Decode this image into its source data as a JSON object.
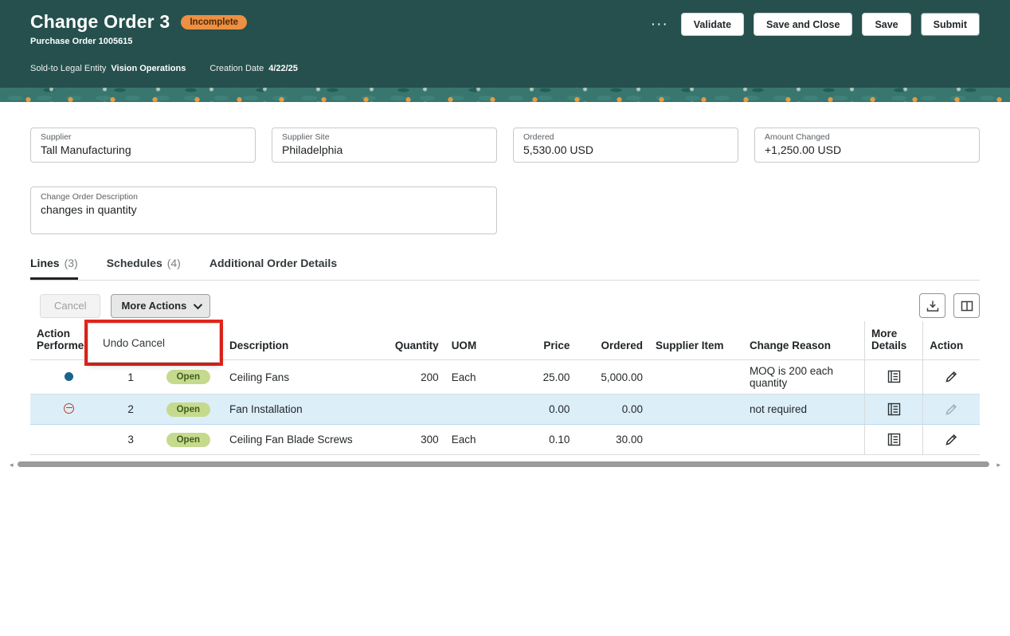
{
  "header": {
    "title": "Change Order 3",
    "status_badge": "Incomplete",
    "subtitle": "Purchase Order 1005615",
    "sold_to_label": "Sold-to Legal Entity",
    "sold_to_value": "Vision Operations",
    "creation_date_label": "Creation Date",
    "creation_date_value": "4/22/25",
    "overflow_glyph": "···",
    "buttons": [
      "Validate",
      "Save and Close",
      "Save",
      "Submit"
    ]
  },
  "fields": [
    {
      "label": "Supplier",
      "value": "Tall Manufacturing"
    },
    {
      "label": "Supplier Site",
      "value": "Philadelphia"
    },
    {
      "label": "Ordered",
      "value": "5,530.00 USD"
    },
    {
      "label": "Amount Changed",
      "value": "+1,250.00 USD"
    }
  ],
  "description_field": {
    "label": "Change Order Description",
    "value": "changes in quantity"
  },
  "tabs": [
    {
      "label": "Lines",
      "count": "(3)"
    },
    {
      "label": "Schedules",
      "count": "(4)"
    },
    {
      "label": "Additional Order Details",
      "count": ""
    }
  ],
  "toolbar": {
    "cancel_label": "Cancel",
    "more_actions_label": "More Actions",
    "menu_item_undo_cancel": "Undo Cancel"
  },
  "table": {
    "columns": {
      "action_performed": "Action Performed",
      "line": "",
      "status": "",
      "description": "Description",
      "quantity": "Quantity",
      "uom": "UOM",
      "price": "Price",
      "ordered": "Ordered",
      "supplier_item": "Supplier Item",
      "change_reason": "Change Reason",
      "more_details": "More Details",
      "action": "Action"
    },
    "rows": [
      {
        "line": "1",
        "status": "Open",
        "description": "Ceiling Fans",
        "quantity": "200",
        "uom": "Each",
        "price": "25.00",
        "ordered": "5,000.00",
        "supplier_item": "",
        "change_reason": "MOQ is 200 each quantity"
      },
      {
        "line": "2",
        "status": "Open",
        "description": "Fan Installation",
        "quantity": "",
        "uom": "",
        "price": "0.00",
        "ordered": "0.00",
        "supplier_item": "",
        "change_reason": "not required"
      },
      {
        "line": "3",
        "status": "Open",
        "description": "Ceiling Fan Blade Screws",
        "quantity": "300",
        "uom": "Each",
        "price": "0.10",
        "ordered": "30.00",
        "supplier_item": "",
        "change_reason": ""
      }
    ]
  },
  "scrollbar": {
    "left_arrow": "◂",
    "right_arrow": "▸"
  },
  "colors": {
    "header_bg": "#25504d",
    "band_bg": "#38766f",
    "incomplete_badge_bg": "#ee8f41",
    "open_badge_bg": "#c6da8e",
    "highlight_row_bg": "#dceef8",
    "annotation_red": "#e8251c",
    "action_dot_blue": "#19648c",
    "cancel_icon_red": "#b5412c"
  }
}
